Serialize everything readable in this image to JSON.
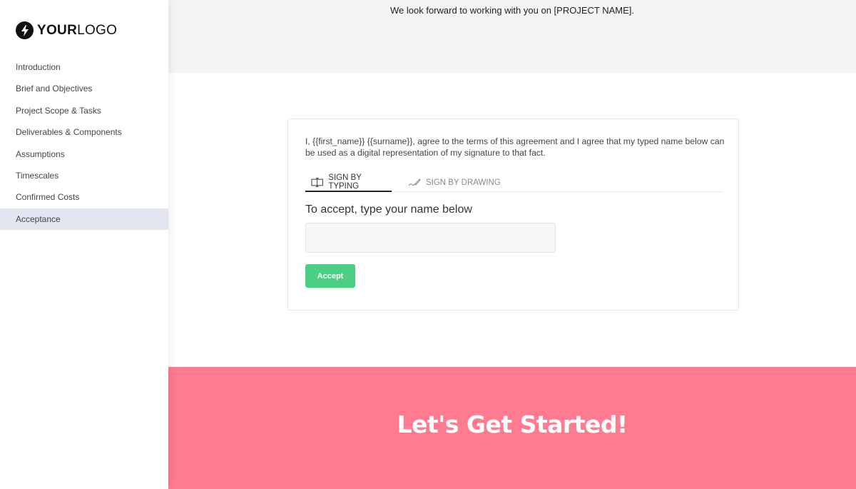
{
  "logo": {
    "bold": "YOUR",
    "light": "LOGO",
    "icon": "lightning-bolt-icon"
  },
  "sidebar": {
    "items": [
      {
        "label": "Introduction"
      },
      {
        "label": "Brief and Objectives"
      },
      {
        "label": "Project Scope & Tasks"
      },
      {
        "label": "Deliverables & Components"
      },
      {
        "label": "Assumptions"
      },
      {
        "label": "Timescales"
      },
      {
        "label": "Confirmed Costs"
      },
      {
        "label": "Acceptance",
        "active": true
      }
    ]
  },
  "main": {
    "top_text": "We look forward to working with you on [PROJECT NAME].",
    "signature": {
      "agreement_text": "I, {{first_name}} {{surname}}, agree to the terms of this agreement and I agree that my typed name below can be used as a digital representation of my signature to that fact.",
      "tabs": [
        {
          "label": "SIGN BY TYPING",
          "icon": "text-cursor-icon",
          "active": true
        },
        {
          "label": "SIGN BY DRAWING",
          "icon": "pen-icon",
          "active": false
        }
      ],
      "input_label": "To accept, type your name below",
      "input_value": "",
      "input_placeholder": "",
      "accept_button": "Accept"
    },
    "banner_title": "Let's Get Started!"
  },
  "colors": {
    "accent_green": "#4cce84",
    "banner_pink": "#ff7b8f",
    "active_nav": "#e3e6ee"
  }
}
